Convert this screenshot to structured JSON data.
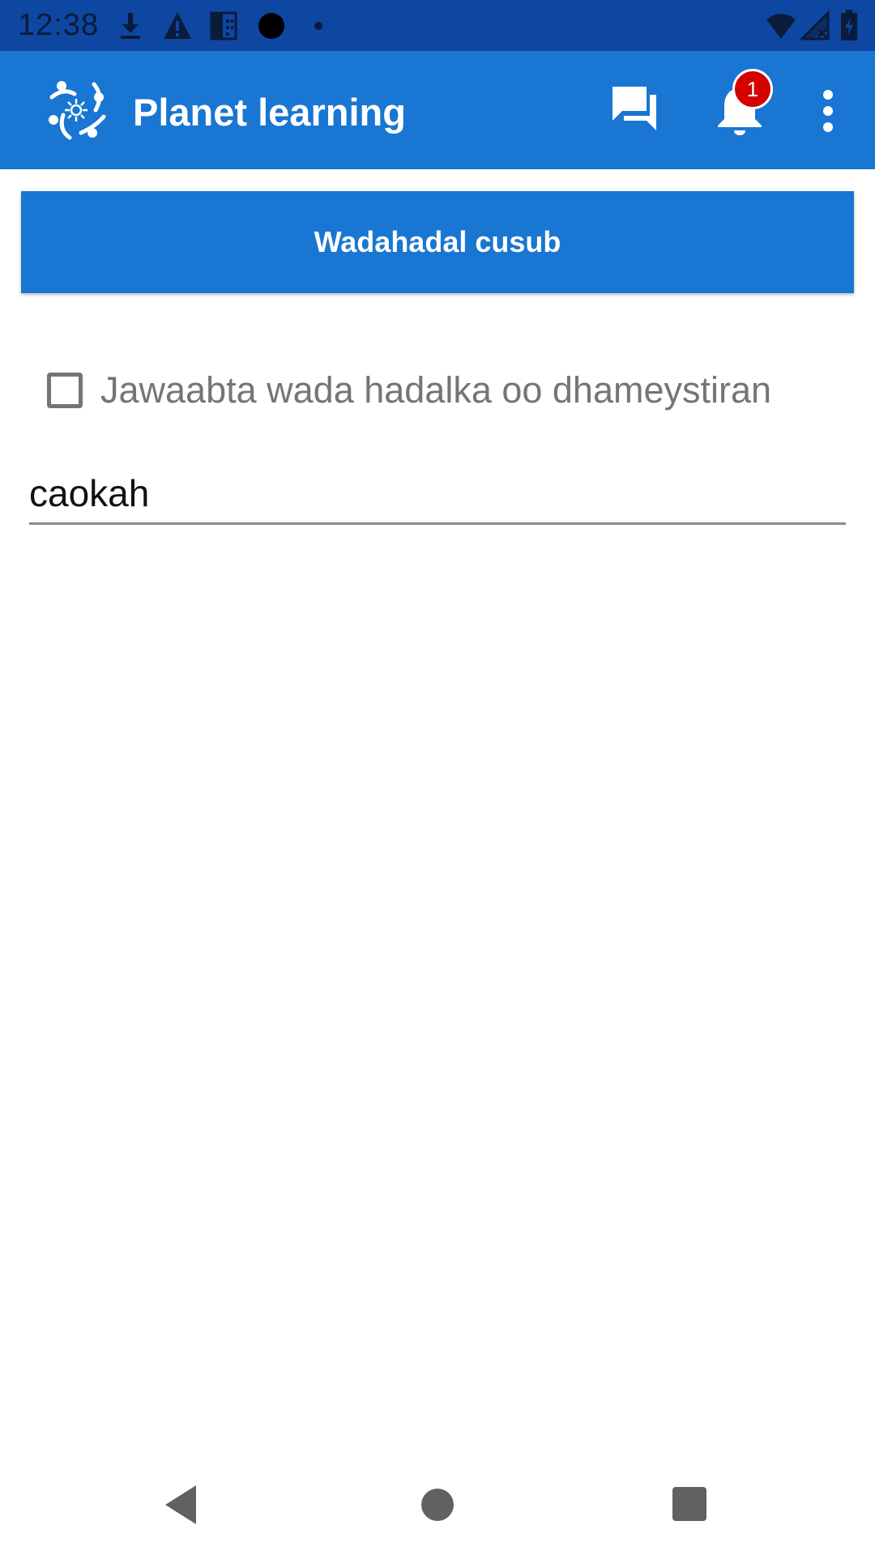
{
  "status_bar": {
    "time": "12:38",
    "icons": [
      "download-icon",
      "warning-icon",
      "building-icon",
      "record-dot-icon",
      "small-dot-icon",
      "wifi-icon",
      "signal-icon",
      "battery-charging-icon"
    ]
  },
  "app_bar": {
    "title": "Planet learning",
    "notification_count": "1",
    "icons": [
      "planet-logo-icon",
      "chat-icon",
      "bell-icon",
      "more-vert-icon"
    ]
  },
  "main": {
    "new_discussion_label": "Wadahadal cusub",
    "checkbox_label": "Jawaabta wada hadalka oo dhameystiran",
    "checkbox_checked": false,
    "text_field_value": "caokah"
  },
  "colors": {
    "status_bar": "#0d47a1",
    "primary": "#1976d2",
    "badge": "#d50000"
  },
  "nav_bar": {
    "icons": [
      "back-icon",
      "home-icon",
      "recents-icon"
    ]
  }
}
